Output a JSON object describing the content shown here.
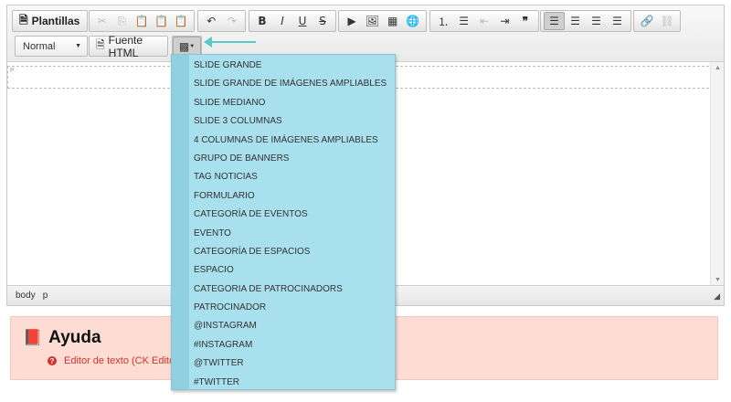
{
  "toolbar": {
    "templates_label": "Plantillas",
    "source_label": "Fuente HTML",
    "format_value": "Normal",
    "icons": [
      "cut-icon",
      "copy-icon",
      "paste-icon",
      "paste-text-icon",
      "paste-word-icon",
      "undo-icon",
      "redo-icon",
      "bold-icon",
      "italic-icon",
      "underline-icon",
      "strike-icon",
      "media-icon",
      "image-icon",
      "table-icon",
      "iframe-icon",
      "numbered-list-icon",
      "bullet-list-icon",
      "outdent-icon",
      "indent-icon",
      "blockquote-icon",
      "align-left-icon",
      "align-center-icon",
      "align-right-icon",
      "justify-icon",
      "link-icon",
      "unlink-icon",
      "widget-icon"
    ]
  },
  "editor": {
    "p_tag": "P",
    "status_path": [
      "body",
      "p"
    ]
  },
  "dropdown": {
    "items": [
      "SLIDE GRANDE",
      "SLIDE GRANDE DE IMÁGENES AMPLIABLES",
      "SLIDE MEDIANO",
      "SLIDE 3 COLUMNAS",
      "4 COLUMNAS DE IMÁGENES AMPLIABLES",
      "GRUPO DE BANNERS",
      "TAG NOTICIAS",
      "FORMULARIO",
      "CATEGORÍA DE EVENTOS",
      "EVENTO",
      "CATEGORÍA DE ESPACIOS",
      "ESPACIO",
      "CATEGORIA DE PATROCINADORS",
      "PATROCINADOR",
      "@INSTAGRAM",
      "#INSTAGRAM",
      "@TWITTER",
      "#TWITTER"
    ]
  },
  "help": {
    "title": "Ayuda",
    "item": "Editor de texto (CK Edito"
  },
  "colors": {
    "dropdown_bg": "#a9e0ee",
    "arrow": "#5cc7c7",
    "help_bg": "#fddcd3",
    "help_text": "#d2322d"
  }
}
